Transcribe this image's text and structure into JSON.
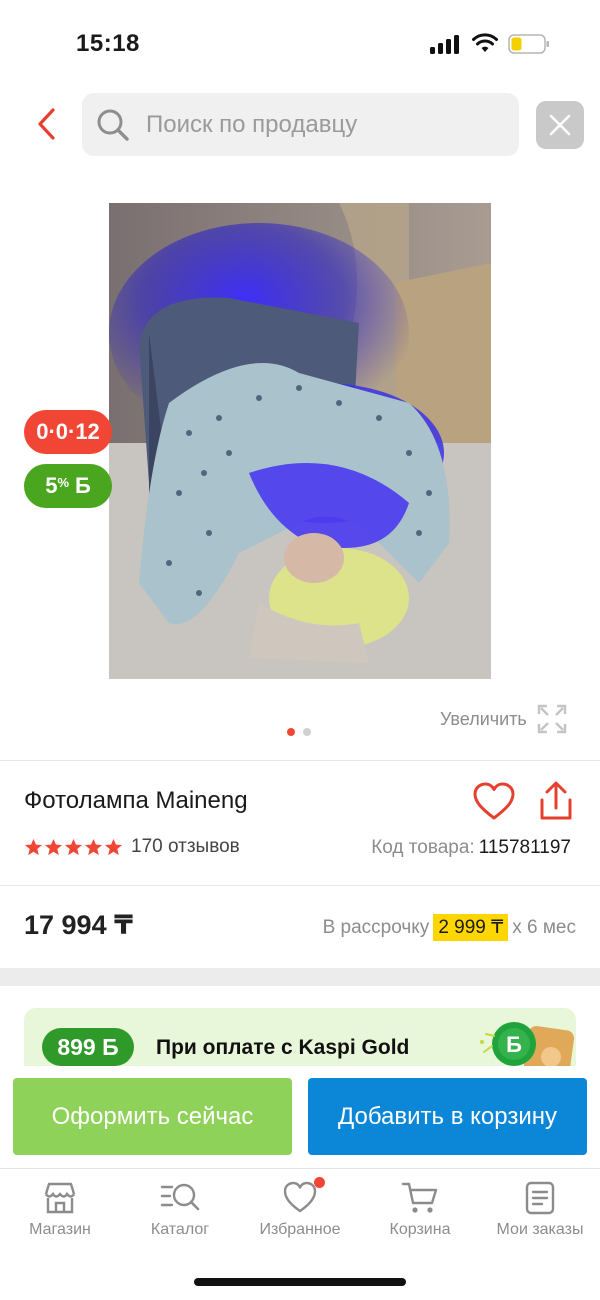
{
  "status_bar": {
    "time": "15:18"
  },
  "search": {
    "placeholder": "Поиск по продавцу"
  },
  "badges": {
    "installment": "0·0·12",
    "bonus_percent": "5",
    "bonus_percent_sign": "%",
    "bonus_currency": "Б"
  },
  "gallery": {
    "zoom_label": "Увеличить",
    "image_count": 2,
    "current_image": 1
  },
  "product": {
    "title": "Фотолампа Maineng",
    "rating": 5,
    "reviews": "170 отзывов",
    "sku_label": "Код товара:",
    "sku_value": "115781197"
  },
  "pricing": {
    "price": "17 994 ₸",
    "installment_prefix": "В рассрочку",
    "installment_amount": "2 999 ₸",
    "installment_suffix": "х 6 мес"
  },
  "promo": {
    "badge": "899 Б",
    "text": "При оплате с Kaspi Gold"
  },
  "actions": {
    "order_now": "Оформить сейчас",
    "add_to_cart": "Добавить в корзину"
  },
  "tabs": [
    {
      "label": "Магазин",
      "icon": "store-icon"
    },
    {
      "label": "Каталог",
      "icon": "catalog-search-icon"
    },
    {
      "label": "Избранное",
      "icon": "heart-icon",
      "notification": true
    },
    {
      "label": "Корзина",
      "icon": "cart-icon"
    },
    {
      "label": "Мои заказы",
      "icon": "orders-icon"
    }
  ],
  "colors": {
    "accent_red": "#f14635",
    "bonus_green": "#4aa61e",
    "order_button": "#8fd25a",
    "cart_button": "#0c86d6",
    "installment_highlight": "#ffd600"
  }
}
